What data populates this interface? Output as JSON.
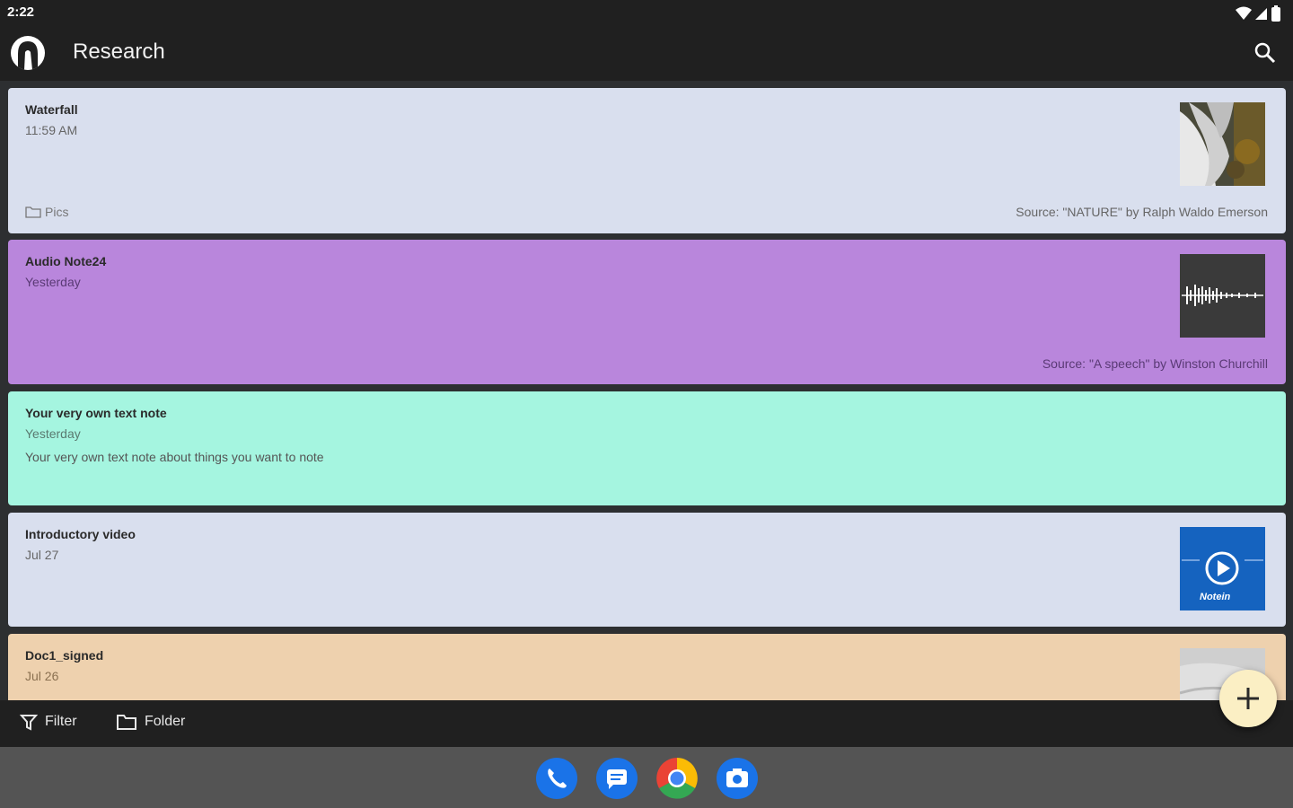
{
  "status_bar": {
    "time": "2:22"
  },
  "app_bar": {
    "title": "Research"
  },
  "notes": [
    {
      "title": "Waterfall",
      "date": "11:59 AM",
      "folder": "Pics",
      "source": "Source: \"NATURE\" by Ralph Waldo Emerson",
      "color": "#d9dfee",
      "thumbnail": "waterfall-image"
    },
    {
      "title": "Audio Note24",
      "date": "Yesterday",
      "source": "Source: \"A speech\" by Winston Churchill",
      "color": "#b986dc",
      "thumbnail": "audio-waveform"
    },
    {
      "title": "Your very own text note",
      "date": "Yesterday",
      "body": "Your very own text note about things you want to note",
      "color": "#a5f5e0"
    },
    {
      "title": "Introductory video",
      "date": "Jul 27",
      "color": "#d9dfee",
      "thumbnail": "video-thumbnail",
      "thumbnail_brand": "Notein"
    },
    {
      "title": "Doc1_signed",
      "date": "Jul 26",
      "color": "#eed1ae",
      "thumbnail": "document-image"
    }
  ],
  "bottom_bar": {
    "filter_label": "Filter",
    "folder_label": "Folder"
  },
  "fab": {
    "icon": "plus-icon",
    "color": "#fbefc4"
  },
  "dock": [
    "phone-app",
    "messages-app",
    "chrome-app",
    "camera-app"
  ]
}
